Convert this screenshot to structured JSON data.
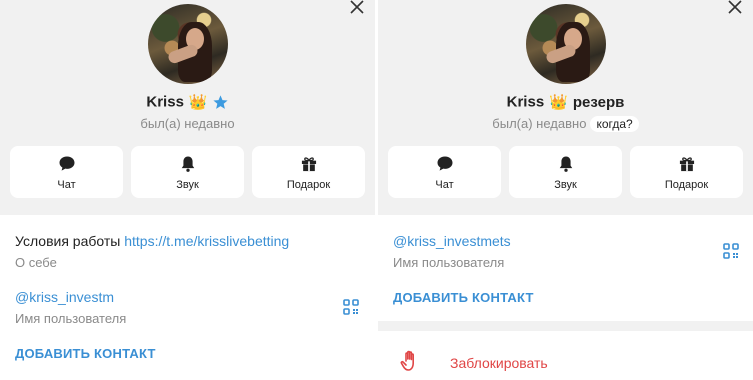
{
  "left": {
    "name": "Kriss",
    "emoji": "👑",
    "status": "был(а) недавно",
    "actions": [
      {
        "label": "Чат",
        "icon": "chat-icon"
      },
      {
        "label": "Звук",
        "icon": "bell-icon"
      },
      {
        "label": "Подарок",
        "icon": "gift-icon"
      }
    ],
    "bio_prefix": "Условия работы ",
    "bio_link": "https://t.me/krisslivebetting",
    "bio_caption": "О себе",
    "username": "@kriss_investm",
    "username_caption": "Имя пользователя",
    "add_contact": "ДОБАВИТЬ КОНТАКТ"
  },
  "right": {
    "name": "Kriss",
    "emoji": "👑",
    "name_suffix": "резерв",
    "status": "был(а) недавно",
    "when_badge": "когда?",
    "actions": [
      {
        "label": "Чат",
        "icon": "chat-icon"
      },
      {
        "label": "Звук",
        "icon": "bell-icon"
      },
      {
        "label": "Подарок",
        "icon": "gift-icon"
      }
    ],
    "username": "@kriss_investmets",
    "username_caption": "Имя пользователя",
    "add_contact": "ДОБАВИТЬ КОНТАКТ",
    "block": "Заблокировать"
  },
  "colors": {
    "accent": "#3a8fd4",
    "danger": "#e04646",
    "background": "#f1f1f1",
    "card": "#ffffff",
    "secondary_text": "#8a8a8a"
  }
}
